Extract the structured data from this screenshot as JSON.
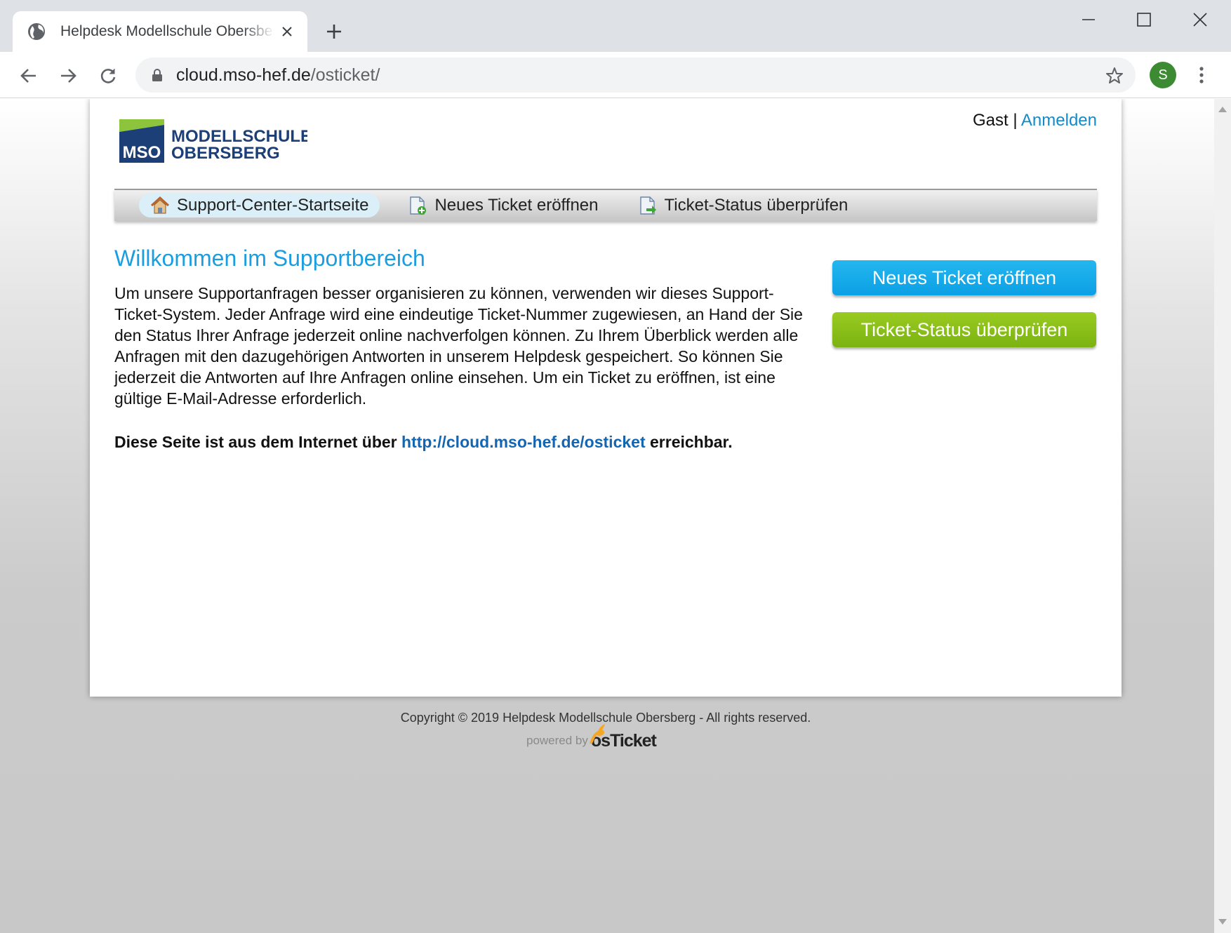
{
  "browser": {
    "tab_title": "Helpdesk Modellschule Obersberg",
    "url_host": "cloud.mso-hef.de",
    "url_path": "/osticket/",
    "profile_initial": "S"
  },
  "page": {
    "logo": {
      "badge": "MSO",
      "line1": "MODELLSCHULE",
      "line2": "OBERSBERG"
    },
    "user": {
      "guest": "Gast",
      "separator": "|",
      "login": "Anmelden"
    },
    "nav": [
      {
        "label": "Support-Center-Startseite",
        "icon": "home-icon",
        "active": true
      },
      {
        "label": "Neues Ticket eröffnen",
        "icon": "new-ticket-icon",
        "active": false
      },
      {
        "label": "Ticket-Status überprüfen",
        "icon": "ticket-status-icon",
        "active": false
      }
    ],
    "heading": "Willkommen im Supportbereich",
    "intro": "Um unsere Supportanfragen besser organisieren zu können, verwenden wir dieses Support-Ticket-System. Jeder Anfrage wird eine eindeutige Ticket-Nummer zugewiesen, an Hand der Sie den Status Ihrer Anfrage jederzeit online nachverfolgen können. Zu Ihrem Überblick werden alle Anfragen mit den dazugehörigen Antworten in unserem Helpdesk gespeichert. So können Sie jederzeit die Antworten auf Ihre Anfragen online einsehen. Um ein Ticket zu eröffnen, ist eine gültige E-Mail-Adresse erforderlich.",
    "reach": {
      "prefix": "Diese Seite ist aus dem Internet über",
      "link": "http://cloud.mso-hef.de/osticket",
      "suffix": "erreichbar."
    },
    "buttons": {
      "new_ticket": "Neues Ticket eröffnen",
      "check_status": "Ticket-Status überprüfen"
    },
    "footer": {
      "copyright": "Copyright © 2019 Helpdesk Modellschule Obersberg - All rights reserved.",
      "powered_by": "powered by",
      "brand": "osTicket"
    }
  },
  "colors": {
    "heading": "#1b9ee0",
    "link": "#128bc8",
    "btn_new": "#0ba0e4",
    "btn_status": "#7cb311",
    "logo_blue": "#1c3f78",
    "logo_green": "#8cc43c"
  }
}
